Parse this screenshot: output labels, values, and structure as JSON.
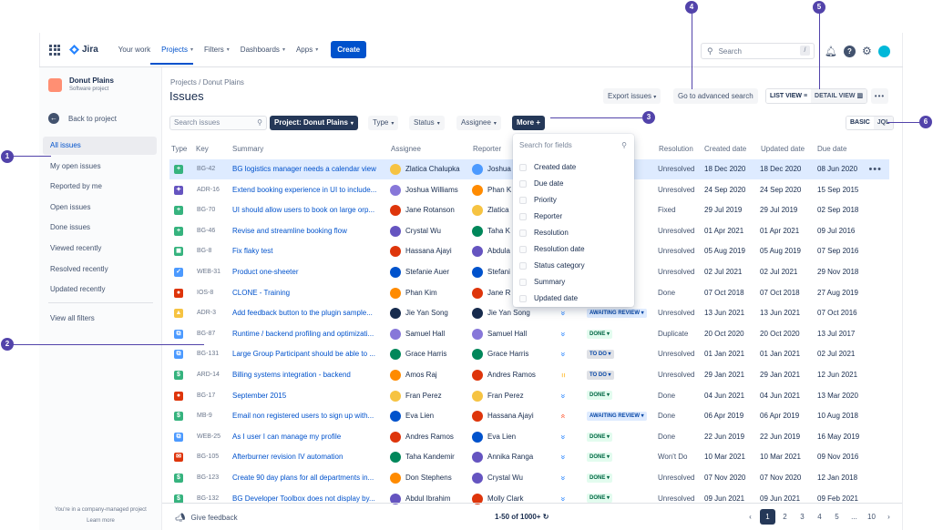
{
  "nav": {
    "logo": "Jira",
    "items": [
      {
        "label": "Your work",
        "chevron": false,
        "active": false
      },
      {
        "label": "Projects",
        "chevron": true,
        "active": true
      },
      {
        "label": "Filters",
        "chevron": true,
        "active": false
      },
      {
        "label": "Dashboards",
        "chevron": true,
        "active": false
      },
      {
        "label": "Apps",
        "chevron": true,
        "active": false
      }
    ],
    "create": "Create",
    "search_placeholder": "Search",
    "search_shortcut": "/"
  },
  "sidebar": {
    "project_name": "Donut Plains",
    "project_type": "Software project",
    "back": "Back to project",
    "items": [
      "All issues",
      "My open issues",
      "Reported by me",
      "Open issues",
      "Done issues",
      "Viewed recently",
      "Resolved recently",
      "Updated recently"
    ],
    "view_all": "View all filters",
    "footer_text": "You're in a company-managed project",
    "learn_more": "Learn more"
  },
  "header": {
    "breadcrumb": "Projects / Donut Plains",
    "title": "Issues",
    "export": "Export issues",
    "advanced": "Go to advanced search",
    "list_view": "LIST VIEW ≡",
    "detail_view": "DETAIL VIEW ▥",
    "more": "•••",
    "basic": "BASIC",
    "jql": "JQL"
  },
  "filters": {
    "search_placeholder": "Search issues",
    "project": "Project: Donut Plains",
    "type": "Type",
    "status": "Status",
    "assignee": "Assignee",
    "more": "More +"
  },
  "columns": [
    "Type",
    "Key",
    "Summary",
    "Assignee",
    "Reporter",
    "Resolution",
    "Created date",
    "Updated date",
    "Due date"
  ],
  "dropdown": {
    "placeholder": "Search for fields",
    "items": [
      "Created date",
      "Due date",
      "Priority",
      "Reporter",
      "Resolution",
      "Resolution date",
      "Status category",
      "Summary",
      "Updated date"
    ]
  },
  "rows": [
    {
      "type_color": "#36b37e",
      "type_glyph": "+",
      "key": "BG-42",
      "summary": "BG logistics manager needs a calendar view",
      "assignee": "Zlatica Chalupka",
      "a_color": "#f6c342",
      "reporter": "Joshua",
      "r_color": "#4c9aff",
      "priority": "",
      "p_color": "#ffffff",
      "status": "",
      "s_bg": "#ffffff",
      "s_fg": "#ffffff",
      "resolution": "Unresolved",
      "created": "18 Dec 2020",
      "updated": "18 Dec 2020",
      "due": "08 Jun 2020",
      "selected": true
    },
    {
      "type_color": "#6554c0",
      "type_glyph": "✦",
      "key": "ADR-16",
      "summary": "Extend booking experience in UI to include...",
      "assignee": "Joshua Williams",
      "a_color": "#8777d9",
      "reporter": "Phan K",
      "r_color": "#ff8b00",
      "priority": "",
      "p_color": "#ffffff",
      "status": "",
      "s_bg": "#ffffff",
      "s_fg": "#ffffff",
      "resolution": "Unresolved",
      "created": "24 Sep 2020",
      "updated": "24 Sep 2020",
      "due": "15 Sep 2015",
      "selected": false
    },
    {
      "type_color": "#36b37e",
      "type_glyph": "+",
      "key": "BG-70",
      "summary": "UI should allow users to book on large orp...",
      "assignee": "Jane Rotanson",
      "a_color": "#de350b",
      "reporter": "Zlatica",
      "r_color": "#f6c342",
      "priority": "",
      "p_color": "#ffffff",
      "status": "",
      "s_bg": "#ffffff",
      "s_fg": "#ffffff",
      "resolution": "Fixed",
      "created": "29 Jul 2019",
      "updated": "29 Jul 2019",
      "due": "02 Sep 2018",
      "selected": false
    },
    {
      "type_color": "#36b37e",
      "type_glyph": "+",
      "key": "BG-46",
      "summary": "Revise and streamline booking flow",
      "assignee": "Crystal Wu",
      "a_color": "#6554c0",
      "reporter": "Taha K",
      "r_color": "#00875a",
      "priority": "",
      "p_color": "#ffffff",
      "status": "",
      "s_bg": "#ffffff",
      "s_fg": "#ffffff",
      "resolution": "Unresolved",
      "created": "01 Apr 2021",
      "updated": "01 Apr 2021",
      "due": "09 Jul 2016",
      "selected": false
    },
    {
      "type_color": "#36b37e",
      "type_glyph": "◼",
      "key": "BG-8",
      "summary": "Fix flaky test",
      "assignee": "Hassana Ajayi",
      "a_color": "#de350b",
      "reporter": "Abdula",
      "r_color": "#6554c0",
      "priority": "",
      "p_color": "#ffffff",
      "status": "",
      "s_bg": "#ffffff",
      "s_fg": "#ffffff",
      "resolution": "Unresolved",
      "created": "05 Aug 2019",
      "updated": "05 Aug 2019",
      "due": "07 Sep 2016",
      "selected": false
    },
    {
      "type_color": "#4c9aff",
      "type_glyph": "✓",
      "key": "WEB-31",
      "summary": "Product one-sheeter",
      "assignee": "Stefanie Auer",
      "a_color": "#0052cc",
      "reporter": "Stefani",
      "r_color": "#0052cc",
      "priority": "",
      "p_color": "#ffffff",
      "status": "",
      "s_bg": "#ffffff",
      "s_fg": "#ffffff",
      "resolution": "Unresolved",
      "created": "02 Jul 2021",
      "updated": "02 Jul 2021",
      "due": "29 Nov 2018",
      "selected": false
    },
    {
      "type_color": "#de350b",
      "type_glyph": "●",
      "key": "IOS-8",
      "summary": "CLONE - Training",
      "assignee": "Phan Kim",
      "a_color": "#ff8b00",
      "reporter": "Jane R",
      "r_color": "#de350b",
      "priority": "",
      "p_color": "#ffffff",
      "status": "",
      "s_bg": "#ffffff",
      "s_fg": "#ffffff",
      "resolution": "Done",
      "created": "07 Oct 2018",
      "updated": "07 Oct 2018",
      "due": "27 Aug 2019",
      "selected": false
    },
    {
      "type_color": "#f6c342",
      "type_glyph": "▲",
      "key": "ADR-3",
      "summary": "Add feedback button to the plugin sample...",
      "assignee": "Jie Yan Song",
      "a_color": "#172b4d",
      "reporter": "Jie Yan Song",
      "r_color": "#172b4d",
      "priority": "»",
      "p_color": "#2684ff",
      "status": "AWAITING REVIEW ▾",
      "s_bg": "#deebff",
      "s_fg": "#0747a6",
      "resolution": "Unresolved",
      "created": "13 Jun 2021",
      "updated": "13 Jun 2021",
      "due": "07 Oct 2016",
      "selected": false
    },
    {
      "type_color": "#4c9aff",
      "type_glyph": "⧉",
      "key": "BG-87",
      "summary": "Runtime / backend profiling and optimizati...",
      "assignee": "Samuel Hall",
      "a_color": "#8777d9",
      "reporter": "Samuel Hall",
      "r_color": "#8777d9",
      "priority": "»",
      "p_color": "#2684ff",
      "status": "DONE ▾",
      "s_bg": "#e3fcef",
      "s_fg": "#006644",
      "resolution": "Duplicate",
      "created": "20 Oct 2020",
      "updated": "20 Oct 2020",
      "due": "13 Jul 2017",
      "selected": false
    },
    {
      "type_color": "#4c9aff",
      "type_glyph": "⧉",
      "key": "BG-131",
      "summary": "Large Group Participant should be able to ...",
      "assignee": "Grace Harris",
      "a_color": "#00875a",
      "reporter": "Grace Harris",
      "r_color": "#00875a",
      "priority": "»",
      "p_color": "#2684ff",
      "status": "TO DO ▾",
      "s_bg": "#dfe1e6",
      "s_fg": "#0747a6",
      "resolution": "Unresolved",
      "created": "01 Jan 2021",
      "updated": "01 Jan 2021",
      "due": "02 Jul 2021",
      "selected": false
    },
    {
      "type_color": "#36b37e",
      "type_glyph": "$",
      "key": "ARD-14",
      "summary": "Billing systems integration - backend",
      "assignee": "Amos Raj",
      "a_color": "#ff8b00",
      "reporter": "Andres Ramos",
      "r_color": "#de350b",
      "priority": "=",
      "p_color": "#ffab00",
      "status": "TO DO ▾",
      "s_bg": "#dfe1e6",
      "s_fg": "#0747a6",
      "resolution": "Unresolved",
      "created": "29 Jan 2021",
      "updated": "29 Jan 2021",
      "due": "12 Jun 2021",
      "selected": false
    },
    {
      "type_color": "#de350b",
      "type_glyph": "●",
      "key": "BG-17",
      "summary": "September 2015",
      "assignee": "Fran Perez",
      "a_color": "#f6c342",
      "reporter": "Fran Perez",
      "r_color": "#f6c342",
      "priority": "»",
      "p_color": "#2684ff",
      "status": "DONE ▾",
      "s_bg": "#e3fcef",
      "s_fg": "#006644",
      "resolution": "Done",
      "created": "04 Jun 2021",
      "updated": "04 Jun 2021",
      "due": "13 Mar 2020",
      "selected": false
    },
    {
      "type_color": "#36b37e",
      "type_glyph": "$",
      "key": "MB-9",
      "summary": "Email non registered users to sign up with...",
      "assignee": "Eva Lien",
      "a_color": "#0052cc",
      "reporter": "Hassana Ajayi",
      "r_color": "#de350b",
      "priority": "«",
      "p_color": "#ff5630",
      "status": "AWAITING REVIEW ▾",
      "s_bg": "#deebff",
      "s_fg": "#0747a6",
      "resolution": "Done",
      "created": "06 Apr 2019",
      "updated": "06 Apr 2019",
      "due": "10 Aug 2018",
      "selected": false
    },
    {
      "type_color": "#4c9aff",
      "type_glyph": "⧉",
      "key": "WEB-25",
      "summary": "As I user I can manage my profile",
      "assignee": "Andres Ramos",
      "a_color": "#de350b",
      "reporter": "Eva Lien",
      "r_color": "#0052cc",
      "priority": "»",
      "p_color": "#2684ff",
      "status": "DONE ▾",
      "s_bg": "#e3fcef",
      "s_fg": "#006644",
      "resolution": "Done",
      "created": "22 Jun 2019",
      "updated": "22 Jun 2019",
      "due": "16 May 2019",
      "selected": false
    },
    {
      "type_color": "#de350b",
      "type_glyph": "✉",
      "key": "BG-105",
      "summary": "Afterburner revision IV automation",
      "assignee": "Taha Kandemir",
      "a_color": "#00875a",
      "reporter": "Annika Ranga",
      "r_color": "#6554c0",
      "priority": "»",
      "p_color": "#2684ff",
      "status": "DONE ▾",
      "s_bg": "#e3fcef",
      "s_fg": "#006644",
      "resolution": "Won't Do",
      "created": "10 Mar 2021",
      "updated": "10 Mar 2021",
      "due": "09 Nov 2016",
      "selected": false
    },
    {
      "type_color": "#36b37e",
      "type_glyph": "$",
      "key": "BG-123",
      "summary": "Create 90 day plans for all departments in...",
      "assignee": "Don Stephens",
      "a_color": "#ff8b00",
      "reporter": "Crystal Wu",
      "r_color": "#6554c0",
      "priority": "»",
      "p_color": "#2684ff",
      "status": "DONE ▾",
      "s_bg": "#e3fcef",
      "s_fg": "#006644",
      "resolution": "Unresolved",
      "created": "07 Nov 2020",
      "updated": "07 Nov 2020",
      "due": "12 Jan 2018",
      "selected": false
    },
    {
      "type_color": "#36b37e",
      "type_glyph": "$",
      "key": "BG-132",
      "summary": "BG Developer Toolbox does not display by...",
      "assignee": "Abdul Ibrahim",
      "a_color": "#6554c0",
      "reporter": "Molly Clark",
      "r_color": "#de350b",
      "priority": "»",
      "p_color": "#2684ff",
      "status": "DONE ▾",
      "s_bg": "#e3fcef",
      "s_fg": "#006644",
      "resolution": "Unresolved",
      "created": "09 Jun 2021",
      "updated": "09 Jun 2021",
      "due": "09 Feb 2021",
      "selected": false
    }
  ],
  "row_more": "•••",
  "footer": {
    "feedback": "Give feedback",
    "count": "1-50 of 1000+ ↻",
    "pages": [
      "‹",
      "1",
      "2",
      "3",
      "4",
      "5",
      "...",
      "10",
      "›"
    ]
  },
  "callouts": [
    "1",
    "2",
    "3",
    "4",
    "5",
    "6"
  ]
}
